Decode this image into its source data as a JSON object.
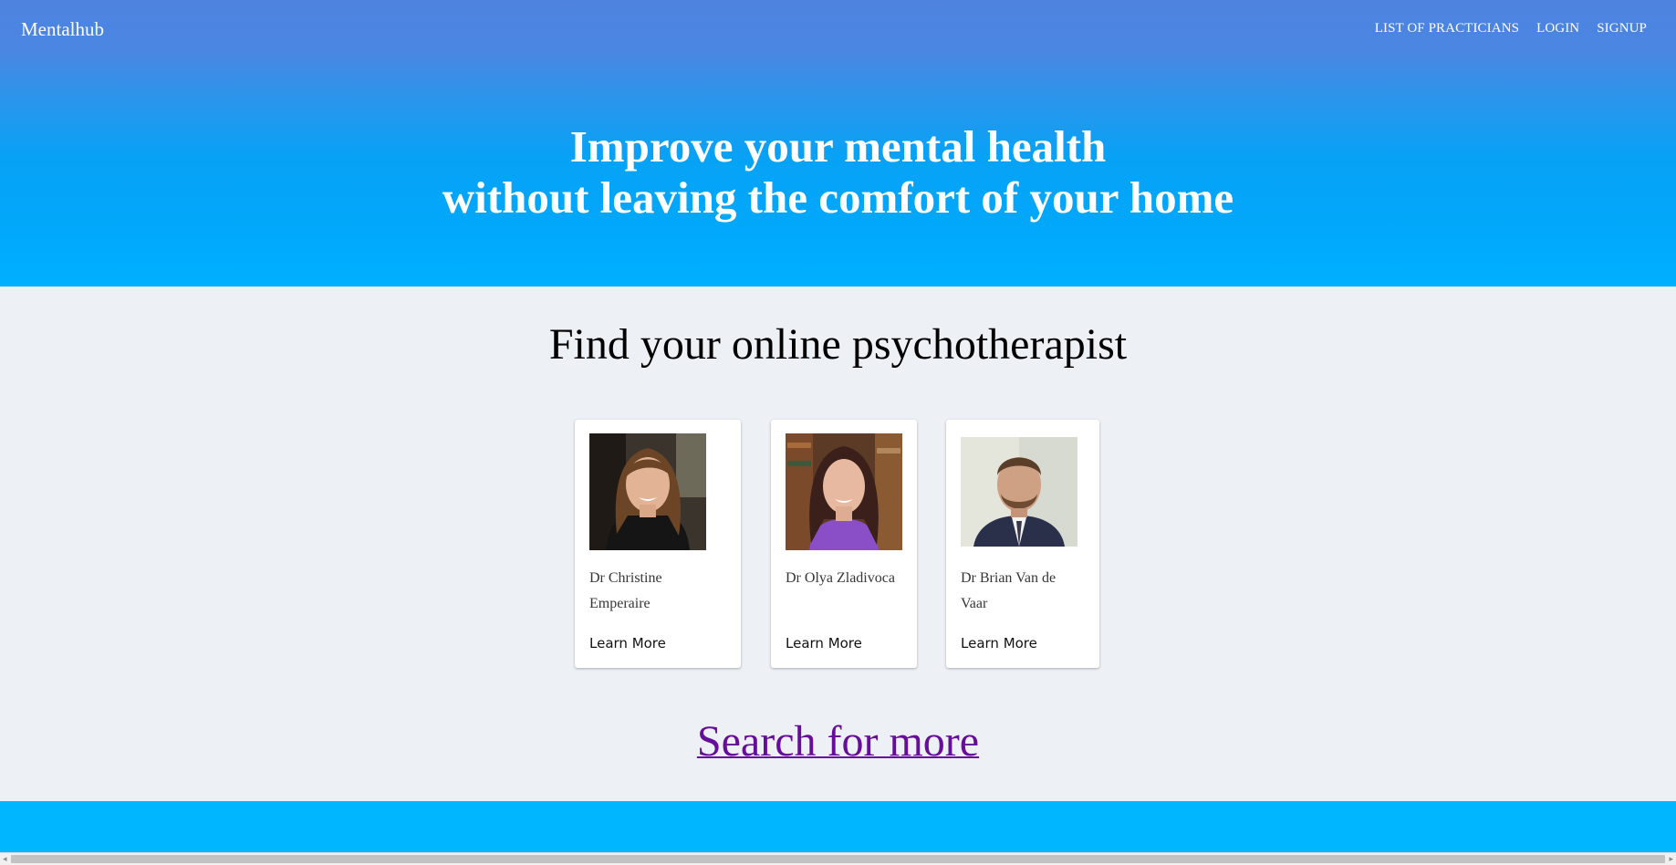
{
  "header": {
    "brand": "Mentalhub",
    "nav": [
      "LIST OF PRACTICIANS",
      "LOGIN",
      "SIGNUP"
    ]
  },
  "hero": {
    "title_line1": "Improve your mental health",
    "title_line2": "without leaving the comfort of your home"
  },
  "main": {
    "section_title": "Find your online psychotherapist",
    "practitioners": [
      {
        "name": "Dr Christine Emperaire",
        "action": "Learn More"
      },
      {
        "name": "Dr Olya Zladivoca",
        "action": "Learn More"
      },
      {
        "name": "Dr Brian Van de Vaar",
        "action": "Learn More"
      }
    ],
    "search_more": "Search for more"
  },
  "colors": {
    "hero_top": "#4e84e0",
    "hero_bottom": "#00b0ff",
    "page_background": "#edf0f4",
    "footer": "#00b6ff",
    "link_visited": "#660e99"
  }
}
